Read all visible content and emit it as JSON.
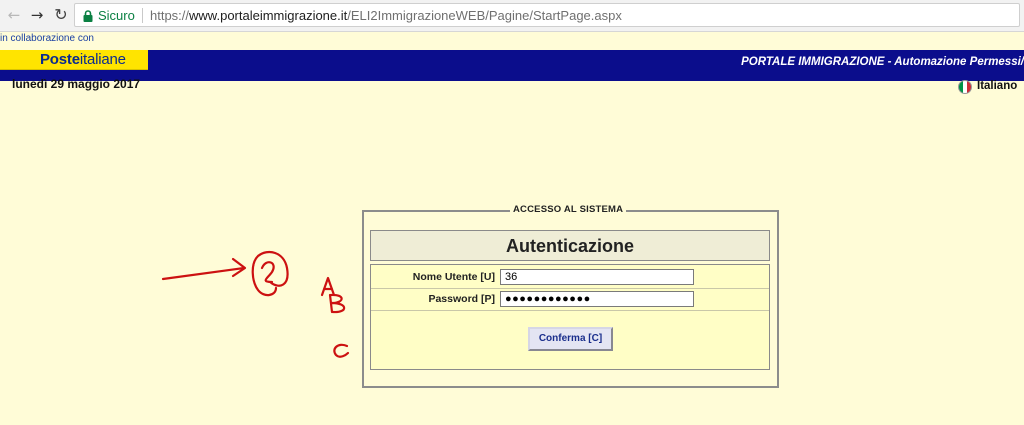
{
  "browser": {
    "secure_label": "Sicuro",
    "url_protocol": "https://",
    "url_host": "www.portaleimmigrazione.it",
    "url_path": "/ELI2ImmigrazioneWEB/Pagine/StartPage.aspx",
    "icons": [
      "back-arrow-icon",
      "forward-arrow-icon",
      "reload-icon",
      "lock-icon"
    ]
  },
  "header": {
    "collab_text": "in collaborazione con",
    "logo_bold": "Poste",
    "logo_rest": "italiane",
    "portal_title": "PORTALE IMMIGRAZIONE - Automazione Permessi/",
    "date": "lunedì 29 maggio 2017",
    "language": "Italiano"
  },
  "login": {
    "legend": "ACCESSO AL SISTEMA",
    "title": "Autenticazione",
    "username_label": "Nome Utente [U]",
    "username_value": "36",
    "password_label": "Password [P]",
    "password_value": "●●●●●●●●●●●●",
    "confirm_label": "Conferma [C]"
  },
  "annotations": {
    "color": "#cc1111"
  },
  "colors": {
    "page_bg": "#fffcd7",
    "header_bar": "#0b0d8c",
    "logo_bg": "#ffe400"
  }
}
